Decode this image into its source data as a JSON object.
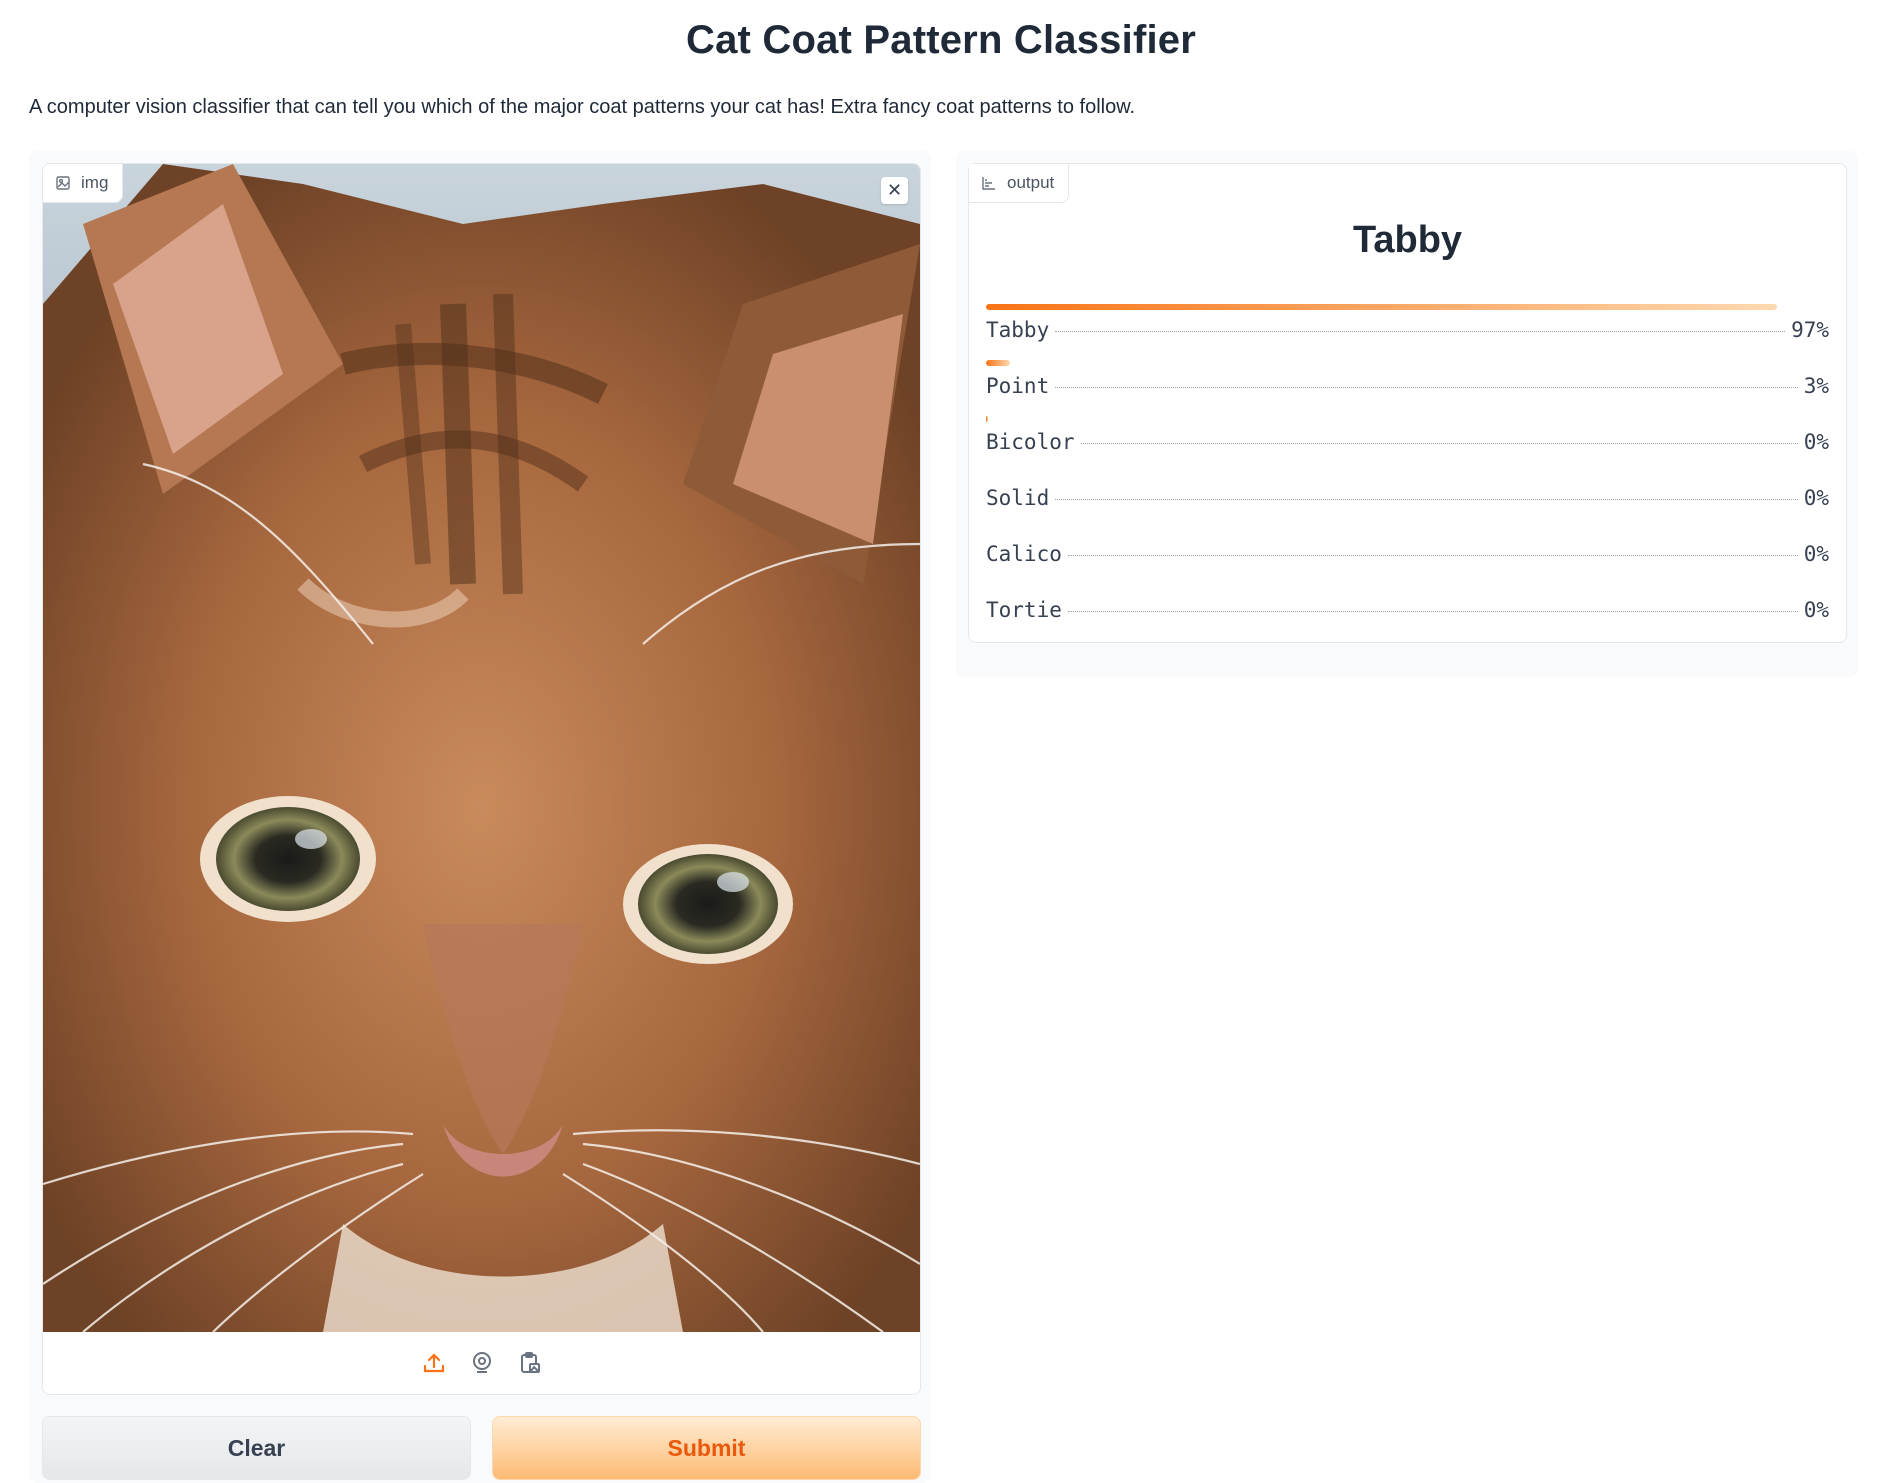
{
  "header": {
    "title": "Cat Coat Pattern Classifier",
    "description": "A computer vision classifier that can tell you which of the major coat patterns your cat has! Extra fancy coat patterns to follow."
  },
  "input": {
    "label": "img",
    "label_icon": "image-icon",
    "close_icon": "close-icon",
    "source_icons": [
      "upload-icon",
      "webcam-icon",
      "clipboard-icon"
    ]
  },
  "buttons": {
    "clear": "Clear",
    "submit": "Submit"
  },
  "output": {
    "label": "output",
    "label_icon": "chart-icon",
    "prediction": "Tabby",
    "confidences": [
      {
        "label": "Tabby",
        "value": "97%",
        "fraction": 0.97
      },
      {
        "label": "Point",
        "value": "3%",
        "fraction": 0.03
      },
      {
        "label": "Bicolor",
        "value": "0%",
        "fraction": 0.002
      },
      {
        "label": "Solid",
        "value": "0%",
        "fraction": 0.0
      },
      {
        "label": "Calico",
        "value": "0%",
        "fraction": 0.0
      },
      {
        "label": "Tortie",
        "value": "0%",
        "fraction": 0.0
      }
    ]
  },
  "colors": {
    "accent": "#f97316",
    "submit_text": "#ea580c"
  }
}
